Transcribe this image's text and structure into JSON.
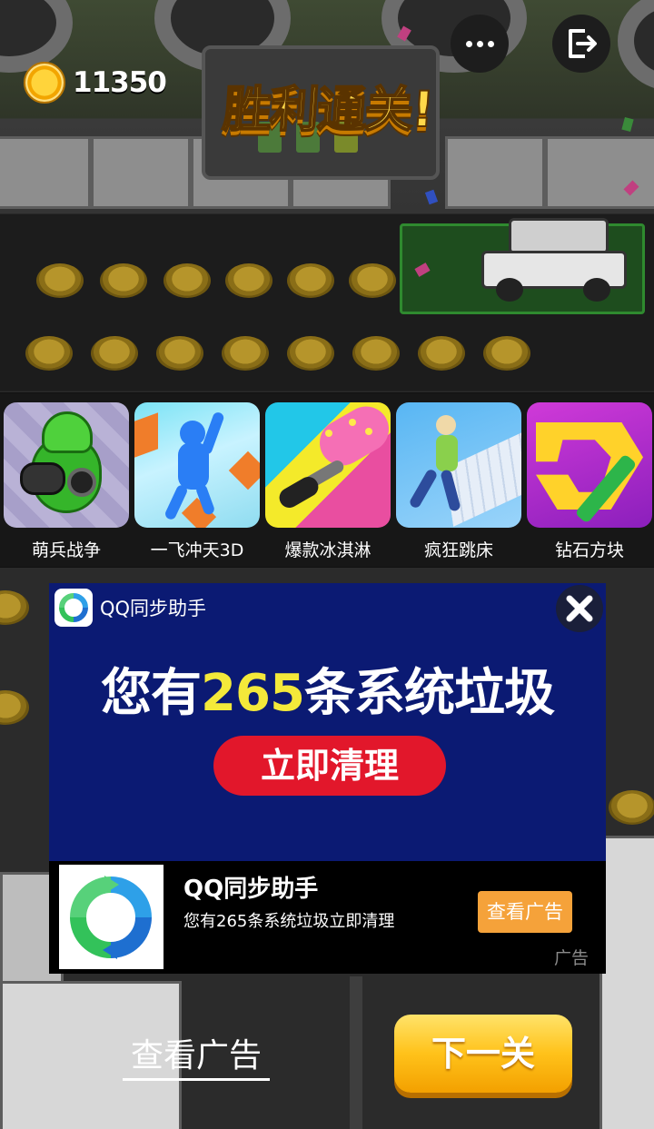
{
  "header": {
    "coin_icon": "gold-coin-icon",
    "coin_count": "11350",
    "title": "胜利通关!",
    "more_icon": "more-dots-icon",
    "exit_icon": "exit-icon"
  },
  "recommend": {
    "games": [
      {
        "label": "萌兵战争",
        "icon": "green-tank-soldier-icon"
      },
      {
        "label": "一飞冲天3D",
        "icon": "blue-runner-icon"
      },
      {
        "label": "爆款冰淇淋",
        "icon": "paint-roller-icon"
      },
      {
        "label": "疯狂跳床",
        "icon": "trampoline-jumper-icon"
      },
      {
        "label": "钻石方块",
        "icon": "diamond-block-icon"
      }
    ]
  },
  "ad": {
    "header_name": "QQ同步助手",
    "close_icon": "close-icon",
    "headline_pre": "您有",
    "headline_number": "265",
    "headline_post": "条系统垃圾",
    "clean_button_label": "立即清理",
    "app_name": "QQ同步助手",
    "app_desc": "您有265条系统垃圾立即清理",
    "view_button_label": "查看广告",
    "tag": "广告",
    "colors": {
      "background": "#0b1a73",
      "highlight": "#f4e93a",
      "button": "#e2172b"
    }
  },
  "footer": {
    "watch_ad_label": "查看广告",
    "next_level_label": "下一关"
  }
}
